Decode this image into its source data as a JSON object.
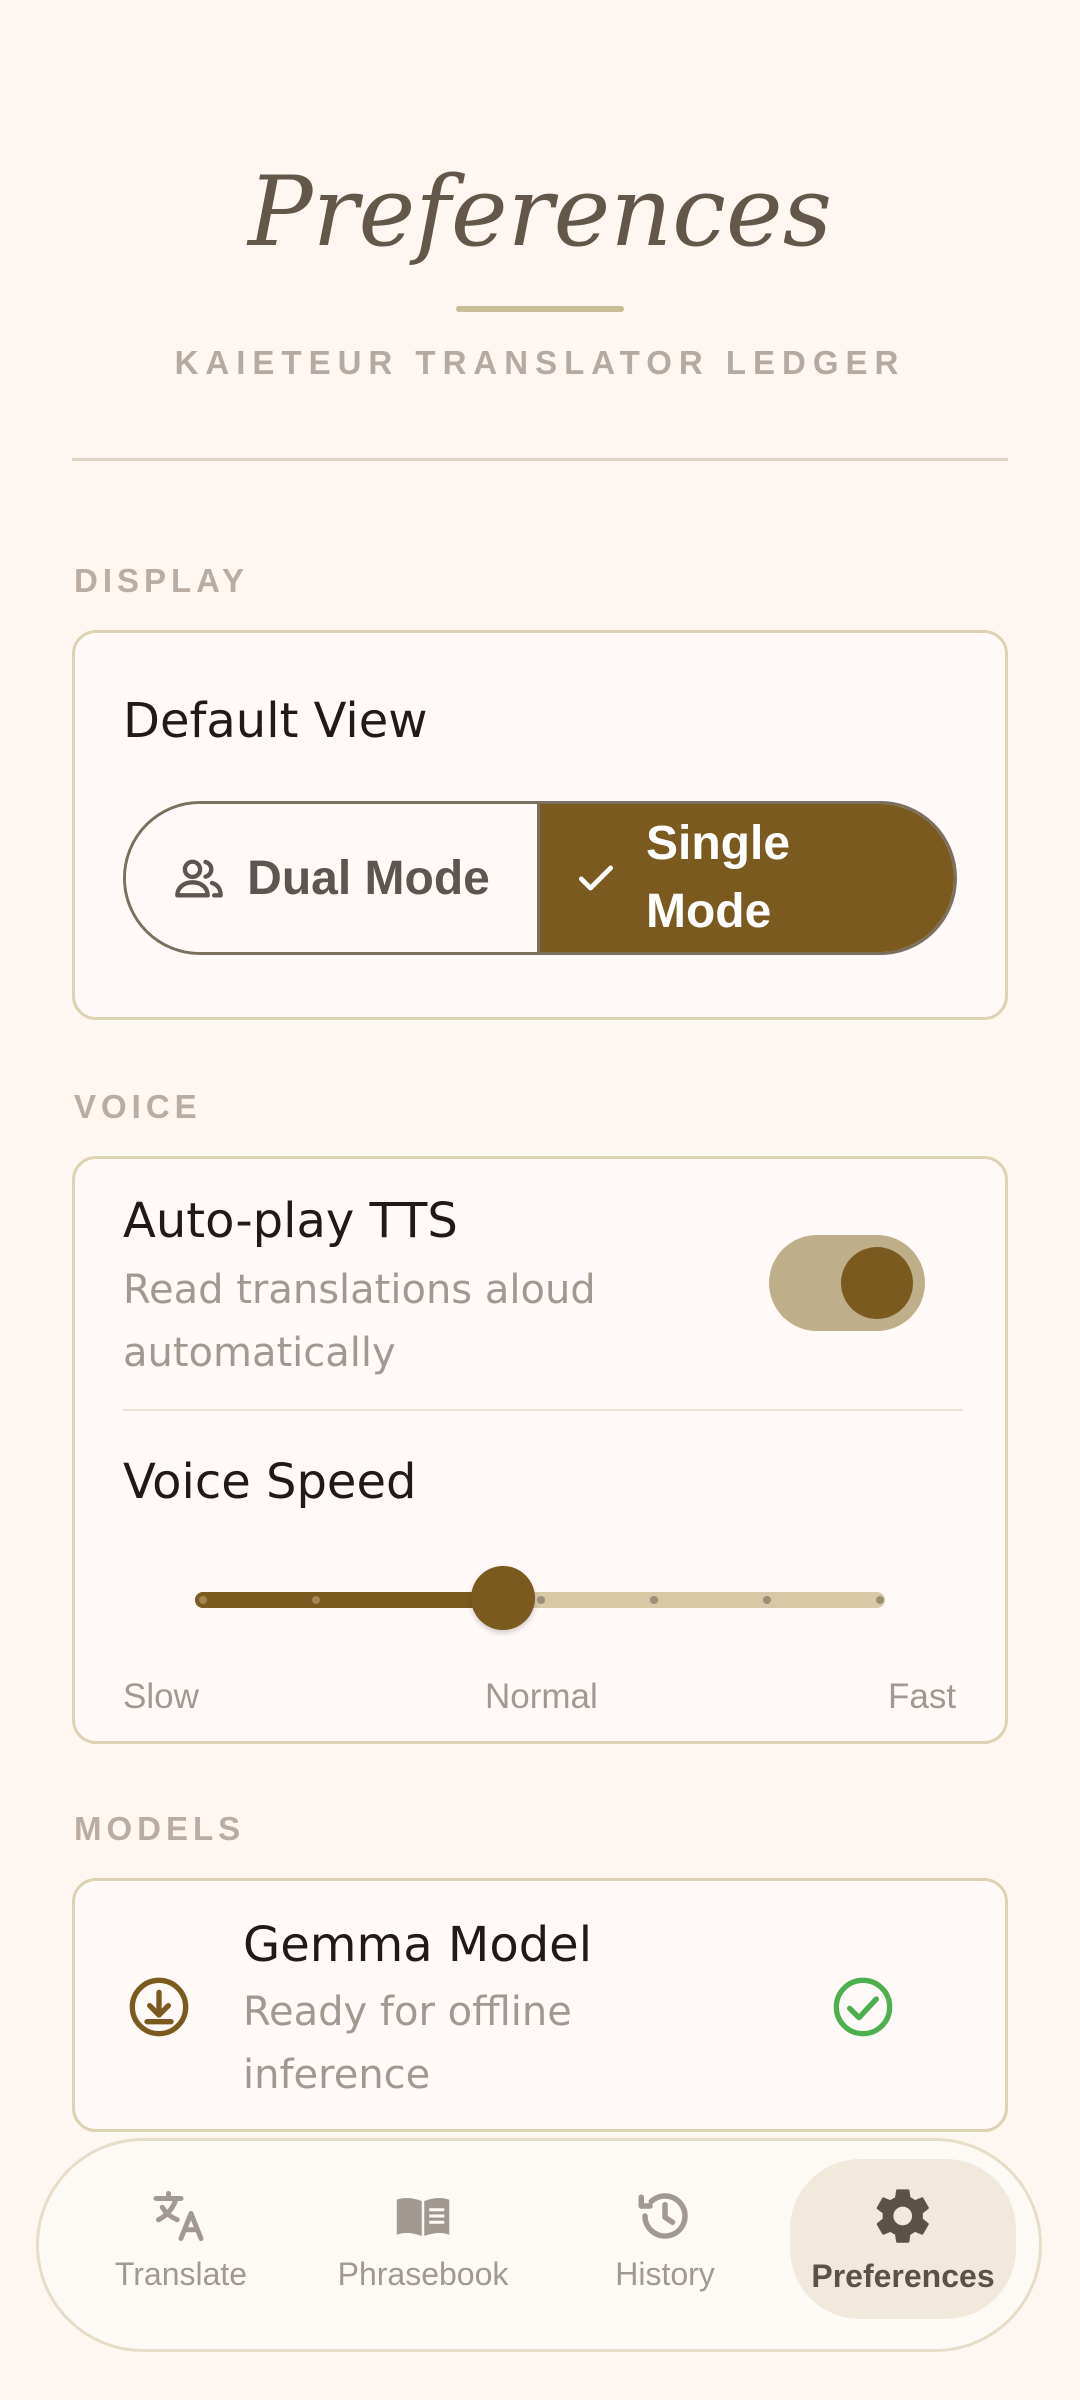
{
  "header": {
    "title": "Preferences",
    "subtitle": "KAIETEUR TRANSLATOR LEDGER"
  },
  "display": {
    "section_label": "DISPLAY",
    "default_view": {
      "title": "Default View",
      "options": [
        "Dual Mode",
        "Single Mode"
      ],
      "selected": "Single Mode",
      "icon_left": "people-icon",
      "icon_right": "check-icon"
    }
  },
  "voice": {
    "section_label": "VOICE",
    "autoplay": {
      "title": "Auto-play TTS",
      "description_line1": "Read translations aloud",
      "description_line2": "automatically",
      "enabled": true
    },
    "speed": {
      "title": "Voice Speed",
      "labels": {
        "slow": "Slow",
        "normal": "Normal",
        "fast": "Fast"
      },
      "steps": 7,
      "value_step": 3
    }
  },
  "models": {
    "section_label": "MODELS",
    "gemma": {
      "title": "Gemma Model",
      "status_line1": "Ready for offline",
      "status_line2": "inference",
      "icon": "download-icon",
      "status_icon": "check-circle-icon"
    }
  },
  "nav": {
    "items": [
      {
        "label": "Translate",
        "icon": "translate-icon",
        "active": false
      },
      {
        "label": "Phrasebook",
        "icon": "book-icon",
        "active": false
      },
      {
        "label": "History",
        "icon": "history-icon",
        "active": false
      },
      {
        "label": "Preferences",
        "icon": "gear-icon",
        "active": true
      }
    ]
  },
  "colors": {
    "accent": "#7a5a1e",
    "background": "#fdf6f1",
    "card_border": "#ddd2b3",
    "success": "#4caf50"
  }
}
